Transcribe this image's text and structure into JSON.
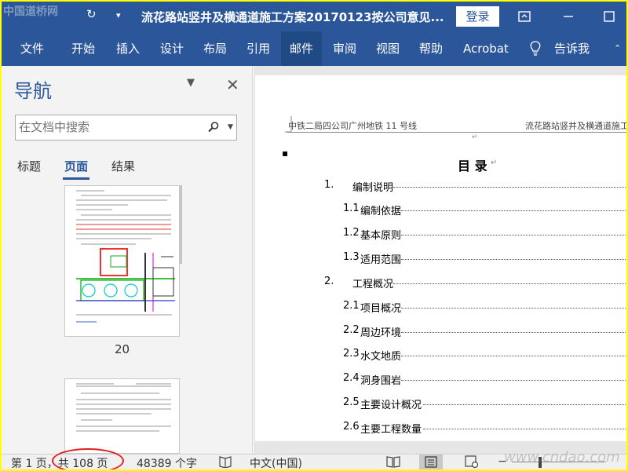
{
  "window": {
    "title": "流花路站竖井及横通道施工方案20170123按公司意见...",
    "login_label": "登录",
    "quick_access": {
      "undo_icon": "undo-icon",
      "redo_icon": "redo-icon",
      "customize_icon": "customize-toolbar-icon"
    }
  },
  "ribbon": {
    "tabs": [
      "文件",
      "开始",
      "插入",
      "设计",
      "布局",
      "引用",
      "邮件",
      "审阅",
      "视图",
      "帮助",
      "Acrobat",
      "告诉我"
    ],
    "active_tab": "邮件",
    "tell_me_icon": "lightbulb-icon"
  },
  "nav": {
    "title": "导航",
    "search_placeholder": "在文档中搜索",
    "tabs": [
      "标题",
      "页面",
      "结果"
    ],
    "active_tab": "页面",
    "thumbnail_page_label": "20"
  },
  "document": {
    "header_left": "中铁二局四公司广州地铁 11 号线",
    "header_right": "流花路站竖井及横通道施工方",
    "toc_title": "目 录",
    "toc": [
      {
        "num": "1.",
        "text": "编制说明",
        "level": 1
      },
      {
        "num": "1.1",
        "text": "编制依据",
        "level": 2
      },
      {
        "num": "1.2",
        "text": "基本原则",
        "level": 2
      },
      {
        "num": "1.3",
        "text": "适用范围",
        "level": 2
      },
      {
        "num": "2.",
        "text": "工程概况",
        "level": 1
      },
      {
        "num": "2.1",
        "text": "项目概况",
        "level": 2
      },
      {
        "num": "2.2",
        "text": "周边环境",
        "level": 2
      },
      {
        "num": "2.3",
        "text": "水文地质",
        "level": 2
      },
      {
        "num": "2.4",
        "text": "洞身围岩",
        "level": 2
      },
      {
        "num": "2.5",
        "text": "主要设计概况",
        "level": 2
      },
      {
        "num": "2.6",
        "text": "主要工程数量",
        "level": 2
      }
    ]
  },
  "status": {
    "page_info": "第 1 页，共 108 页",
    "word_count": "48389 个字",
    "language": "中文(中国)",
    "zoom_minus": "−"
  },
  "watermarks": {
    "top_left": "中国道桥网",
    "bottom_right": "www.cndao.com"
  },
  "colors": {
    "accent": "#2b579a",
    "border_highlight": "#ffff00",
    "annotation": "#e02020"
  }
}
